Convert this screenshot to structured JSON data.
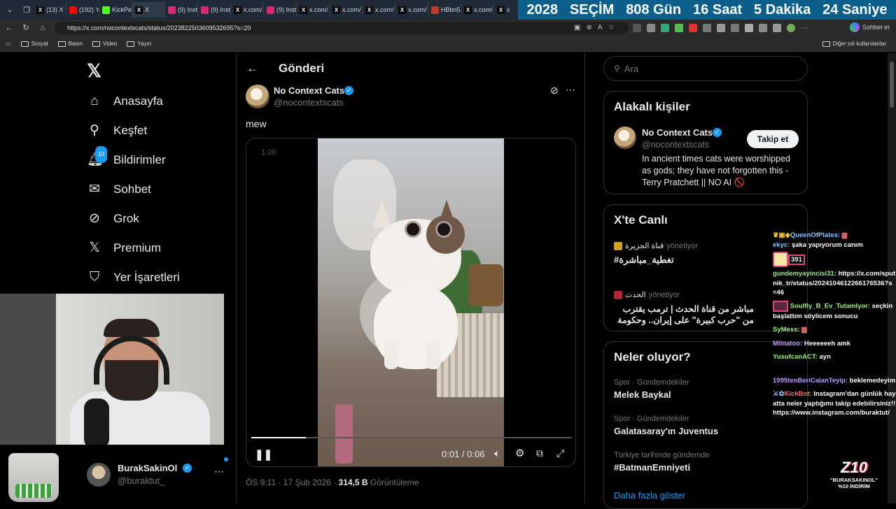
{
  "browser": {
    "tabs": [
      {
        "label": "(13) X",
        "icon": "x-logo-icon",
        "color": "#000000"
      },
      {
        "label": "(192) Y",
        "icon": "youtube-icon",
        "color": "#ff0000"
      },
      {
        "label": "KickPe",
        "icon": "kick-icon",
        "color": "#53fc18"
      },
      {
        "label": "X",
        "icon": "x-logo-icon",
        "color": "#000000",
        "active": true
      },
      {
        "label": "(9) Inst",
        "icon": "instagram-icon",
        "color": "#d62976"
      },
      {
        "label": "(9) Inst",
        "icon": "instagram-icon",
        "color": "#d62976"
      },
      {
        "label": "x.com/",
        "icon": "x-logo-icon",
        "color": "#000000"
      },
      {
        "label": "(9) Inst",
        "icon": "instagram-icon",
        "color": "#d62976"
      },
      {
        "label": "x.com/",
        "icon": "x-logo-icon",
        "color": "#000000"
      },
      {
        "label": "x.com/",
        "icon": "x-logo-icon",
        "color": "#000000"
      },
      {
        "label": "x.com/",
        "icon": "x-logo-icon",
        "color": "#000000"
      },
      {
        "label": "x.com/",
        "icon": "x-logo-icon",
        "color": "#000000"
      },
      {
        "label": "HBbn5",
        "icon": "site-icon",
        "color": "#c0392b"
      },
      {
        "label": "x.com/",
        "icon": "x-logo-icon",
        "color": "#000000"
      },
      {
        "label": "x",
        "icon": "x-logo-icon",
        "color": "#000000"
      }
    ],
    "countdown": [
      "2028",
      "SEÇİM",
      "808 Gün",
      "16 Saat",
      "5 Dakika",
      "24 Saniye"
    ],
    "url": "https://x.com/nocontextscats/status/2023822503609532695?s=20",
    "copilot_label": "Sohbet et",
    "bookmarks": [
      "Sosyal",
      "Basın",
      "Video",
      "Yayın"
    ],
    "bookmarks_other": "Diğer sık kullanılanlar"
  },
  "leftnav": {
    "items": [
      {
        "label": "Anasayfa",
        "icon": "home-icon"
      },
      {
        "label": "Keşfet",
        "icon": "search-icon"
      },
      {
        "label": "Bildirimler",
        "icon": "bell-icon",
        "badge": "10"
      },
      {
        "label": "Sohbet",
        "icon": "mail-icon"
      },
      {
        "label": "Grok",
        "icon": "grok-icon"
      },
      {
        "label": "Premium",
        "icon": "x-logo-icon"
      },
      {
        "label": "Yer İşaretleri",
        "icon": "bookmark-icon"
      }
    ],
    "account": {
      "name": "BurakSakinOl",
      "handle": "@buraktut_"
    }
  },
  "post": {
    "header_title": "Gönderi",
    "author_name": "No Context Cats",
    "author_handle": "@nocontextscats",
    "text": "mew",
    "speed": "1.00",
    "time": "0:01 / 0:06",
    "progress": 0.17,
    "timestamp": "ÖS 9:11 · 17 Şub 2026 · ",
    "views_value": "314,5 B",
    "views_label": " Görüntüleme"
  },
  "sidebar": {
    "search_placeholder": "Ara",
    "related_title": "Alakalı kişiler",
    "related": {
      "name": "No Context Cats",
      "handle": "@nocontextscats",
      "follow": "Takip et",
      "bio": "In ancient times cats were worshipped as gods; they have not forgotten this - Terry Pratchett || NO AI 🚫"
    },
    "live_title": "X'te Canlı",
    "live": [
      {
        "host": "قناة الجزيرة",
        "suffix": "yönetiyor",
        "title": "#تغطية_مباشرة"
      },
      {
        "host": "الحدث",
        "suffix": "yönetiyor",
        "title": "مباشر من قناة الحدث | ترمب يقترب من \"حرب كبيرة\" على إيران.. وحكومة"
      }
    ],
    "trends_title": "Neler oluyor?",
    "trends": [
      {
        "context": "Spor · Gündemdekiler",
        "title": "Melek Baykal"
      },
      {
        "context": "Spor · Gündemdekiler",
        "title": "Galatasaray'ın Juventus"
      },
      {
        "context": "Türkiye tarihinde gündemde",
        "title": "#BatmanEmniyeti"
      }
    ],
    "show_more": "Daha fazla göster"
  },
  "stream": {
    "chat": [
      {
        "user": "QueenOfPlates:",
        "msg": "",
        "color": "#8ec5ff"
      },
      {
        "user": "ekyc:",
        "msg": "şaka yapıyorum canım",
        "color": "#8ec5ff"
      },
      {
        "user": "",
        "msg": "391",
        "color": "#ffffff"
      },
      {
        "user": "gundemyayincisi31:",
        "msg": "https://x.com/sputnik_tr/status/2024104612266176536?s=46",
        "color": "#9cf27a"
      },
      {
        "user": "Soulfly_B_Ev_Tutamlyor:",
        "msg": "seçkin başlattım söylicem sonucu",
        "color": "#9cf27a"
      },
      {
        "user": "SyMess:",
        "msg": "",
        "color": "#9cf27a"
      },
      {
        "user": "Milnatoo:",
        "msg": "Heeeeeeh amk",
        "color": "#c39bff"
      },
      {
        "user": "YusufcanACT:",
        "msg": "ayn",
        "color": "#9cf27a"
      },
      {
        "user": "1995tenBeriCalanTeyip:",
        "msg": "beklemedeyim",
        "color": "#c39bff"
      },
      {
        "user": "KickBot:",
        "msg": "Instagram'dan günlük hayatta neler yaptığımı takip edebilirsiniz!! https://www.instagram.com/buraktut/",
        "color": "#ff6b6b"
      }
    ],
    "promo_logo": "Z10",
    "promo_line1": "\"BURAKSAKINOL\"",
    "promo_line2": "%10 İNDİRİM"
  }
}
